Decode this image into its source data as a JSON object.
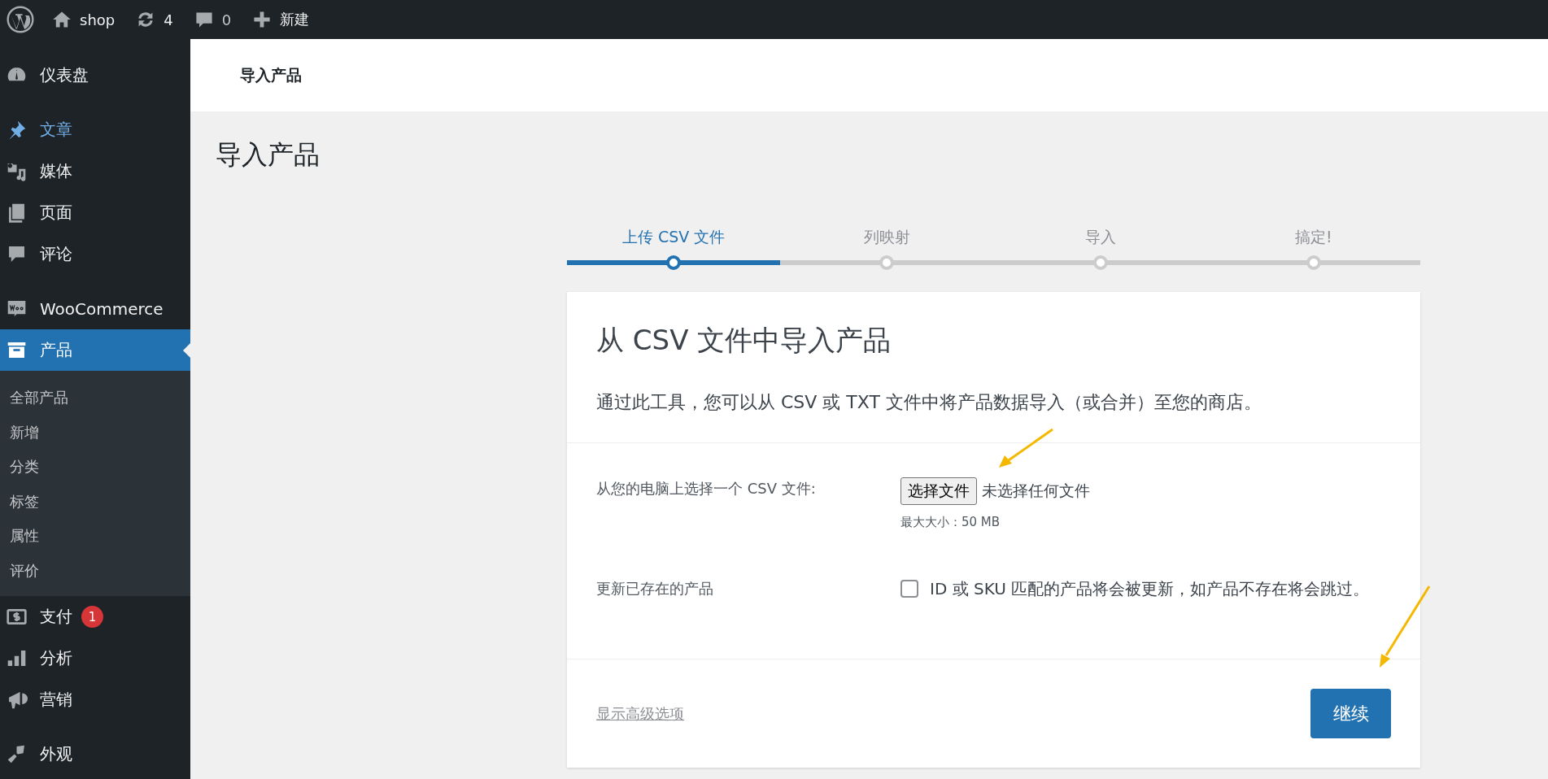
{
  "admin_bar": {
    "items": [
      {
        "kind": "logo"
      },
      {
        "kind": "home",
        "label": "shop"
      },
      {
        "kind": "updates",
        "label": "4"
      },
      {
        "kind": "comments",
        "label": "0"
      },
      {
        "kind": "new",
        "label": "新建"
      }
    ]
  },
  "sidebar": {
    "groups": [
      [
        {
          "kind": "dashboard",
          "label": "仪表盘",
          "selected": false,
          "hover": false
        }
      ],
      [
        {
          "kind": "pin",
          "label": "文章",
          "selected": false,
          "hover": true
        },
        {
          "kind": "media",
          "label": "媒体",
          "selected": false,
          "hover": false
        },
        {
          "kind": "page",
          "label": "页面",
          "selected": false,
          "hover": false
        },
        {
          "kind": "comment",
          "label": "评论",
          "selected": false,
          "hover": false
        }
      ],
      [
        {
          "kind": "woo",
          "label": "WooCommerce",
          "selected": false,
          "hover": false
        },
        {
          "kind": "box",
          "label": "产品",
          "selected": true,
          "hover": false,
          "submenu": [
            "全部产品",
            "新增",
            "分类",
            "标签",
            "属性",
            "评价"
          ]
        },
        {
          "kind": "dollar",
          "label": "支付",
          "selected": false,
          "hover": false,
          "badge": "1"
        },
        {
          "kind": "chart",
          "label": "分析",
          "selected": false,
          "hover": false
        },
        {
          "kind": "megaphone",
          "label": "营销",
          "selected": false,
          "hover": false
        }
      ],
      [
        {
          "kind": "brush",
          "label": "外观",
          "selected": false,
          "hover": false
        }
      ]
    ]
  },
  "header": {
    "title": "导入产品"
  },
  "page_title": "导入产品",
  "steps": [
    {
      "label": "上传 CSV 文件",
      "selected": true
    },
    {
      "label": "列映射",
      "selected": false
    },
    {
      "label": "导入",
      "selected": false
    },
    {
      "label": "搞定!",
      "selected": false
    }
  ],
  "card": {
    "title": "从 CSV 文件中导入产品",
    "description": "通过此工具，您可以从 CSV 或 TXT 文件中将产品数据导入（或合并）至您的商店。",
    "file_row": {
      "label": "从您的电脑上选择一个 CSV 文件:",
      "button": "选择文件",
      "status": "未选择任何文件",
      "hint": "最大大小：50 MB"
    },
    "update_row": {
      "label": "更新已存在的产品",
      "checked": false,
      "text": "ID 或 SKU 匹配的产品将会被更新，如产品不存在将会跳过。"
    },
    "advanced_link": "显示高级选项",
    "continue_button": "继续"
  }
}
